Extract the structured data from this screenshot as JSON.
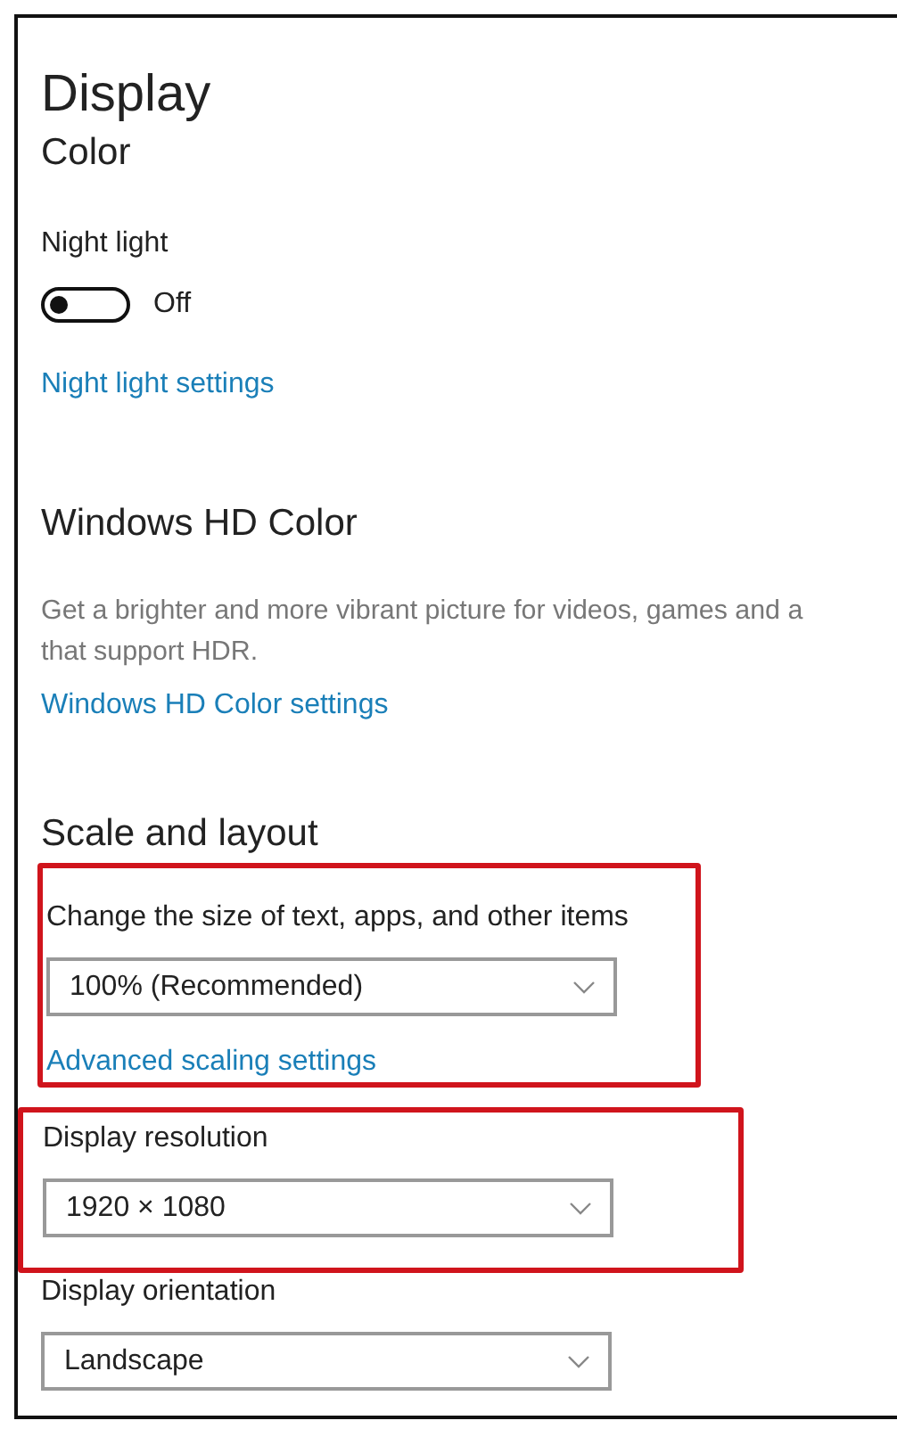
{
  "page_title": "Display",
  "color": {
    "title": "Color",
    "night_light": {
      "label": "Night light",
      "on": false,
      "state_text": "Off"
    },
    "link": "Night light settings"
  },
  "hd_color": {
    "title": "Windows HD Color",
    "description": [
      "Get a brighter and more vibrant picture for videos, games and a",
      "that support HDR."
    ],
    "link": "Windows HD Color settings"
  },
  "scale_and_layout": {
    "title": "Scale and layout",
    "groups": [
      {
        "highlighted": true,
        "items": [
          {
            "kind": "dropdown",
            "label": "Change the size of text, apps, and other items",
            "value": "100% (Recommended)"
          },
          {
            "kind": "link",
            "text": "Advanced scaling settings"
          }
        ]
      },
      {
        "highlighted": true,
        "items": [
          {
            "kind": "dropdown",
            "label": "Display resolution",
            "value": "1920 × 1080"
          }
        ]
      },
      {
        "highlighted": false,
        "items": [
          {
            "kind": "dropdown",
            "label": "Display orientation",
            "value": "Landscape"
          }
        ]
      }
    ]
  }
}
